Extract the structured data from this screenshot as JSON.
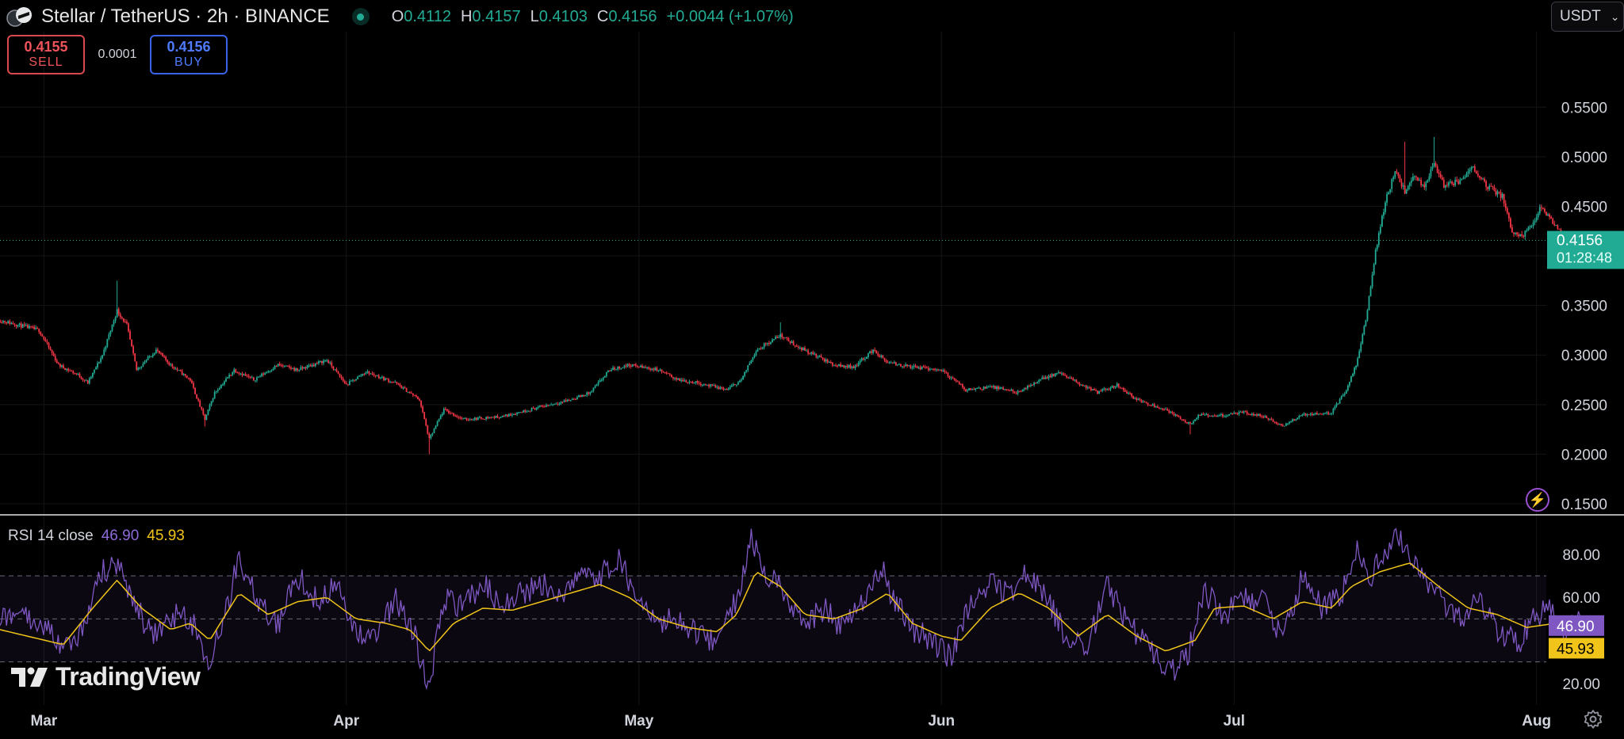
{
  "header": {
    "symbol_title": "Stellar / TetherUS · 2h · BINANCE",
    "ohlc": [
      {
        "key": "O",
        "value": "0.4112"
      },
      {
        "key": "H",
        "value": "0.4157"
      },
      {
        "key": "L",
        "value": "0.4103"
      },
      {
        "key": "C",
        "value": "0.4156"
      }
    ],
    "change": "+0.0044 (+1.07%)"
  },
  "trade": {
    "sell_price": "0.4155",
    "sell_label": "SELL",
    "spread": "0.0001",
    "buy_price": "0.4156",
    "buy_label": "BUY"
  },
  "currency": {
    "label": "USDT"
  },
  "rsi_legend": {
    "name": "RSI 14 close",
    "rsi": "46.90",
    "ma": "45.93"
  },
  "logo": {
    "text": "TradingView"
  },
  "icons": {
    "coin": "stellar-coin-icon",
    "bolt": "lightning-icon",
    "gear": "gear-icon",
    "chevron": "chevron-down-icon"
  },
  "colors": {
    "up": "#22ab94",
    "down": "#f23645",
    "rsi_line": "#7e57c2",
    "rsi_ma": "#f0c419",
    "background": "#000000"
  },
  "chart_data": [
    {
      "type": "candlestick",
      "series_name": "Stellar / TetherUS",
      "interval": "2h",
      "ylim": [
        0.15,
        0.575
      ],
      "y_ticks": [
        "0.5500",
        "0.5000",
        "0.4500",
        "0.4000",
        "0.3500",
        "0.3000",
        "0.2500",
        "0.2000",
        "0.1500"
      ],
      "x_ticks": [
        "Mar",
        "Apr",
        "May",
        "Jun",
        "Jul",
        "Aug"
      ],
      "x_tick_day": [
        1,
        32,
        62,
        93,
        123,
        154
      ],
      "x_range_days": [
        -3.5,
        155
      ],
      "last_price_label": "0.4156",
      "countdown_label": "01:28:48",
      "last_price": 0.4156,
      "close_path": [
        [
          -3.5,
          0.335
        ],
        [
          0.5,
          0.325
        ],
        [
          2.5,
          0.29
        ],
        [
          4.5,
          0.28
        ],
        [
          5.5,
          0.272
        ],
        [
          7,
          0.3
        ],
        [
          8.5,
          0.345
        ],
        [
          9.5,
          0.33
        ],
        [
          10.5,
          0.285
        ],
        [
          12.5,
          0.305
        ],
        [
          14,
          0.29
        ],
        [
          16,
          0.275
        ],
        [
          17.5,
          0.235
        ],
        [
          18.5,
          0.262
        ],
        [
          20.5,
          0.285
        ],
        [
          22.5,
          0.275
        ],
        [
          25,
          0.29
        ],
        [
          27,
          0.285
        ],
        [
          30,
          0.295
        ],
        [
          32,
          0.27
        ],
        [
          34,
          0.283
        ],
        [
          37,
          0.272
        ],
        [
          39.5,
          0.255
        ],
        [
          40.5,
          0.215
        ],
        [
          42,
          0.245
        ],
        [
          44,
          0.235
        ],
        [
          48,
          0.238
        ],
        [
          52,
          0.248
        ],
        [
          55,
          0.255
        ],
        [
          57,
          0.262
        ],
        [
          59,
          0.285
        ],
        [
          61,
          0.29
        ],
        [
          64,
          0.285
        ],
        [
          66,
          0.275
        ],
        [
          68,
          0.272
        ],
        [
          71,
          0.265
        ],
        [
          72.5,
          0.275
        ],
        [
          74,
          0.305
        ],
        [
          76.5,
          0.32
        ],
        [
          78,
          0.31
        ],
        [
          80,
          0.3
        ],
        [
          82,
          0.29
        ],
        [
          84,
          0.288
        ],
        [
          86,
          0.305
        ],
        [
          87.5,
          0.292
        ],
        [
          90,
          0.288
        ],
        [
          93,
          0.285
        ],
        [
          95.5,
          0.265
        ],
        [
          98,
          0.268
        ],
        [
          101,
          0.262
        ],
        [
          103,
          0.275
        ],
        [
          105,
          0.282
        ],
        [
          107,
          0.272
        ],
        [
          109,
          0.262
        ],
        [
          111,
          0.27
        ],
        [
          113,
          0.255
        ],
        [
          116,
          0.245
        ],
        [
          118.5,
          0.23
        ],
        [
          119.5,
          0.24
        ],
        [
          121,
          0.238
        ],
        [
          124,
          0.242
        ],
        [
          126,
          0.238
        ],
        [
          128,
          0.228
        ],
        [
          130,
          0.24
        ],
        [
          133,
          0.242
        ],
        [
          134.5,
          0.265
        ],
        [
          135.5,
          0.29
        ],
        [
          136.5,
          0.335
        ],
        [
          137.5,
          0.405
        ],
        [
          138.5,
          0.455
        ],
        [
          139.5,
          0.485
        ],
        [
          140.5,
          0.465
        ],
        [
          141.5,
          0.48
        ],
        [
          142.5,
          0.47
        ],
        [
          143.5,
          0.495
        ],
        [
          144.5,
          0.47
        ],
        [
          146,
          0.475
        ],
        [
          147.5,
          0.49
        ],
        [
          149,
          0.47
        ],
        [
          150.5,
          0.46
        ],
        [
          151.5,
          0.425
        ],
        [
          152.5,
          0.42
        ],
        [
          153.5,
          0.43
        ],
        [
          154.5,
          0.45
        ],
        [
          156,
          0.43
        ],
        [
          157,
          0.415
        ],
        [
          158,
          0.41
        ],
        [
          158.8,
          0.4156
        ]
      ],
      "annotated_extremes": [
        {
          "day": 8.5,
          "high": 0.375
        },
        {
          "day": 17.5,
          "low": 0.228
        },
        {
          "day": 40.5,
          "low": 0.2
        },
        {
          "day": 76.5,
          "high": 0.333
        },
        {
          "day": 118.5,
          "low": 0.22
        },
        {
          "day": 140.5,
          "high": 0.515
        },
        {
          "day": 143.5,
          "high": 0.52
        }
      ]
    },
    {
      "type": "line",
      "title": "RSI 14 close",
      "ylim": [
        10,
        98
      ],
      "y_ticks": [
        "80.00",
        "60.00",
        "20.00"
      ],
      "guide_levels": [
        70,
        50,
        30
      ],
      "band": [
        30,
        70
      ],
      "series": [
        {
          "name": "RSI",
          "last_value": 46.9,
          "label": "46.90"
        },
        {
          "name": "MA",
          "last_value": 45.93,
          "label": "45.93"
        }
      ],
      "rsi_path": [
        [
          -3.5,
          52
        ],
        [
          1,
          48
        ],
        [
          3,
          35
        ],
        [
          5,
          46
        ],
        [
          7,
          72
        ],
        [
          8.5,
          76
        ],
        [
          10,
          60
        ],
        [
          12,
          42
        ],
        [
          14,
          52
        ],
        [
          16,
          50
        ],
        [
          18,
          30
        ],
        [
          20,
          60
        ],
        [
          21,
          78
        ],
        [
          23,
          58
        ],
        [
          25,
          48
        ],
        [
          27,
          70
        ],
        [
          29,
          58
        ],
        [
          31,
          66
        ],
        [
          33,
          45
        ],
        [
          35,
          40
        ],
        [
          37,
          60
        ],
        [
          39,
          42
        ],
        [
          40.5,
          18
        ],
        [
          42,
          60
        ],
        [
          44,
          55
        ],
        [
          46,
          68
        ],
        [
          48,
          55
        ],
        [
          50,
          62
        ],
        [
          52,
          66
        ],
        [
          54,
          60
        ],
        [
          56,
          72
        ],
        [
          58,
          70
        ],
        [
          60,
          78
        ],
        [
          62,
          55
        ],
        [
          64,
          48
        ],
        [
          66,
          50
        ],
        [
          68,
          42
        ],
        [
          70,
          40
        ],
        [
          72,
          60
        ],
        [
          73.5,
          88
        ],
        [
          75,
          72
        ],
        [
          77,
          62
        ],
        [
          79,
          48
        ],
        [
          81,
          55
        ],
        [
          83,
          45
        ],
        [
          85,
          58
        ],
        [
          87,
          72
        ],
        [
          88,
          60
        ],
        [
          90,
          45
        ],
        [
          92,
          40
        ],
        [
          94,
          32
        ],
        [
          96,
          58
        ],
        [
          98,
          66
        ],
        [
          100,
          62
        ],
        [
          102,
          72
        ],
        [
          104,
          58
        ],
        [
          106,
          40
        ],
        [
          108,
          38
        ],
        [
          110,
          66
        ],
        [
          112,
          48
        ],
        [
          114,
          38
        ],
        [
          116,
          25
        ],
        [
          118,
          30
        ],
        [
          120,
          62
        ],
        [
          122,
          52
        ],
        [
          124,
          60
        ],
        [
          126,
          58
        ],
        [
          128,
          40
        ],
        [
          130,
          70
        ],
        [
          132,
          55
        ],
        [
          134,
          60
        ],
        [
          135.5,
          82
        ],
        [
          137,
          70
        ],
        [
          138.5,
          82
        ],
        [
          140,
          88
        ],
        [
          142,
          70
        ],
        [
          144,
          60
        ],
        [
          146,
          50
        ],
        [
          148,
          58
        ],
        [
          150,
          45
        ],
        [
          152,
          38
        ],
        [
          154,
          52
        ],
        [
          155.5,
          55
        ],
        [
          157,
          40
        ],
        [
          158,
          50
        ],
        [
          158.8,
          46.9
        ]
      ],
      "ma_path": [
        [
          -3.5,
          45
        ],
        [
          3,
          38
        ],
        [
          6,
          55
        ],
        [
          8.5,
          68
        ],
        [
          11,
          55
        ],
        [
          14,
          45
        ],
        [
          16,
          48
        ],
        [
          18,
          40
        ],
        [
          21,
          62
        ],
        [
          24,
          52
        ],
        [
          27,
          58
        ],
        [
          30,
          60
        ],
        [
          33,
          50
        ],
        [
          36,
          48
        ],
        [
          38.5,
          45
        ],
        [
          40.5,
          35
        ],
        [
          43,
          48
        ],
        [
          46,
          55
        ],
        [
          49,
          54
        ],
        [
          52,
          58
        ],
        [
          55,
          62
        ],
        [
          58,
          66
        ],
        [
          61,
          60
        ],
        [
          64,
          50
        ],
        [
          67,
          46
        ],
        [
          70,
          44
        ],
        [
          72,
          52
        ],
        [
          74,
          72
        ],
        [
          76.5,
          65
        ],
        [
          79,
          52
        ],
        [
          82,
          50
        ],
        [
          85,
          55
        ],
        [
          87.5,
          62
        ],
        [
          90,
          48
        ],
        [
          93,
          42
        ],
        [
          95,
          40
        ],
        [
          98,
          55
        ],
        [
          101,
          62
        ],
        [
          104,
          55
        ],
        [
          107,
          42
        ],
        [
          110,
          52
        ],
        [
          113,
          42
        ],
        [
          116,
          35
        ],
        [
          119,
          40
        ],
        [
          121,
          55
        ],
        [
          124,
          56
        ],
        [
          127,
          50
        ],
        [
          130,
          58
        ],
        [
          133,
          55
        ],
        [
          135,
          65
        ],
        [
          138,
          72
        ],
        [
          141,
          76
        ],
        [
          144,
          65
        ],
        [
          147,
          55
        ],
        [
          150,
          52
        ],
        [
          153,
          46
        ],
        [
          156,
          48
        ],
        [
          158.8,
          45.93
        ]
      ]
    }
  ]
}
